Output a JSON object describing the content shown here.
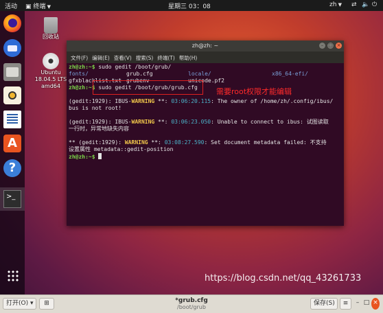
{
  "topbar": {
    "activities": "活动",
    "app_menu": "终端",
    "clock": "星期三 03：08",
    "user": "zh"
  },
  "desktop": {
    "trash_label": "回收站",
    "dvd_label": [
      "Ubuntu",
      "18.04.5 LTS",
      "amd64"
    ],
    "dvd_badge": "DVD"
  },
  "dock": {
    "items": [
      "firefox-icon",
      "thunderbird-icon",
      "files-icon",
      "rhythmbox-icon",
      "libreoffice-writer-icon",
      "software-icon",
      "help-icon",
      "terminal-icon",
      "show-apps-icon"
    ]
  },
  "terminal": {
    "title": "zh@zh: ~",
    "menu": [
      "文件(F)",
      "编辑(E)",
      "查看(V)",
      "搜索(S)",
      "终端(T)",
      "帮助(H)"
    ],
    "prompt": "zh@zh:~$",
    "cmd1": " sudo gedit /boot/grub/",
    "ls": [
      [
        "fonts/",
        "grub.cfg",
        "locale/",
        "x86_64-efi/"
      ],
      [
        "gfxblacklist.txt",
        "grubenv",
        "unicode.pf2",
        ""
      ]
    ],
    "cmd2": " sudo gedit /boot/grub/grub.cfg",
    "msg1": {
      "head": "(gedit:1929): IBUS-",
      "level": "WARNING",
      "mid": " **: ",
      "time": "03:06:20.115",
      "tail": ": The owner of /home/zh/.config/ibus/",
      "cont": "bus is not root!"
    },
    "msg2": {
      "head": "(gedit:1929): IBUS-",
      "level": "WARNING",
      "mid": " **: ",
      "time": "03:06:23.050",
      "tail": ": Unable to connect to ibus: 试图读取",
      "cont": "一行时，异常地缺失内容"
    },
    "msg3": {
      "head": "** (gedit:1929): ",
      "level": "WARNING",
      "mid": " **: ",
      "time": "03:08:27.590",
      "tail": ": Set document metadata failed: 不支持",
      "cont": "设置属性 metadata::gedit-position"
    }
  },
  "annotation": "需要root权限才能编辑",
  "watermark": "https://blog.csdn.net/qq_43261733",
  "gedit": {
    "open_label": "打开(O)",
    "filename": "*grub.cfg",
    "path": "/boot/grub",
    "save_label": "保存(S)"
  },
  "colors": {
    "accent": "#e95420",
    "terminal_bg": "#300a24",
    "prompt": "#7cd74a",
    "warning": "#f2c84b",
    "highlight": "#e02020"
  }
}
